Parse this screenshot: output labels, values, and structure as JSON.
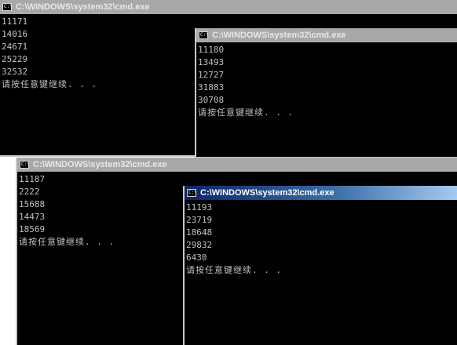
{
  "windows": [
    {
      "title": "C:\\WINDOWS\\system32\\cmd.exe",
      "icon": "cmd-icon",
      "active": false,
      "lines": [
        "11171",
        "14016",
        "24671",
        "25229",
        "32532"
      ],
      "prompt": "请按任意键继续. . ."
    },
    {
      "title": "C:\\WINDOWS\\system32\\cmd.exe",
      "icon": "cmd-icon",
      "active": false,
      "lines": [
        "11180",
        "13493",
        "12727",
        "31883",
        "30708"
      ],
      "prompt": "请按任意键继续. . ."
    },
    {
      "title": "C:\\WINDOWS\\system32\\cmd.exe",
      "icon": "cmd-icon",
      "active": false,
      "lines": [
        "11187",
        "2222",
        "15688",
        "14473",
        "18569"
      ],
      "prompt": "请按任意键继续. . ."
    },
    {
      "title": "C:\\WINDOWS\\system32\\cmd.exe",
      "icon": "cmd-icon",
      "active": true,
      "lines": [
        "11193",
        "23719",
        "18648",
        "29832",
        "6430"
      ],
      "prompt": "请按任意键继续. . ."
    }
  ],
  "colors": {
    "console_bg": "#000000",
    "console_text": "#c0c0c0",
    "active_title_start": "#0a246a",
    "inactive_title": "#a8a8a8"
  }
}
